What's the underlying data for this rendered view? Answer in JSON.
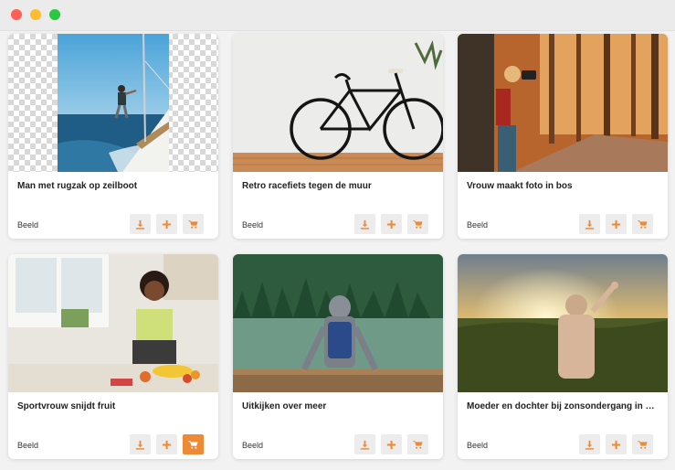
{
  "window": {
    "controls": [
      "close",
      "minimize",
      "maximize"
    ]
  },
  "colors": {
    "accent": "#ee8a36",
    "button_bg": "#ececec"
  },
  "cards": [
    {
      "title": "Man met rugzak op zeilboot",
      "type": "Beeld",
      "cart_active": false
    },
    {
      "title": "Retro racefiets tegen de muur",
      "type": "Beeld",
      "cart_active": false
    },
    {
      "title": "Vrouw maakt foto in bos",
      "type": "Beeld",
      "cart_active": false
    },
    {
      "title": "Sportvrouw snijdt fruit",
      "type": "Beeld",
      "cart_active": true
    },
    {
      "title": "Uitkijken over meer",
      "type": "Beeld",
      "cart_active": false
    },
    {
      "title": "Moeder en dochter bij zonsondergang in het veld",
      "type": "Beeld",
      "cart_active": false
    }
  ],
  "actions": {
    "download": "download-icon",
    "add": "plus-icon",
    "cart": "cart-icon"
  }
}
